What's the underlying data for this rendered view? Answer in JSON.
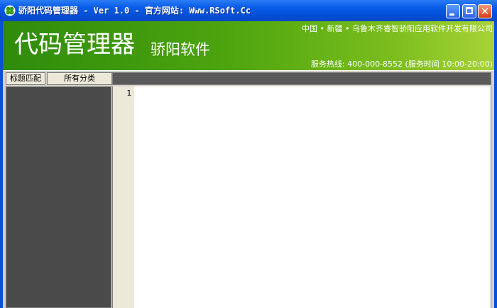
{
  "window": {
    "title": "骄阳代码管理器 - Ver 1.0 - 官方网站: Www.RSoft.Cc"
  },
  "banner": {
    "title": "代码管理器",
    "subtitle": "骄阳软件",
    "company": "中国 • 新疆 • 乌鲁木齐睿智骄阳应用软件开发有限公司",
    "hotline": "服务热线: 400-000-8552 (服务时间 10:00-20:00)"
  },
  "tabs": [
    {
      "label": "标题匹配"
    },
    {
      "label": "所有分类"
    }
  ],
  "editor": {
    "line_numbers": [
      "1"
    ]
  },
  "colors": {
    "titlebar": "#0a5ce8",
    "banner": "#4ca40e",
    "sidebar": "#4a4a4a",
    "gutter": "#ece9d8"
  }
}
